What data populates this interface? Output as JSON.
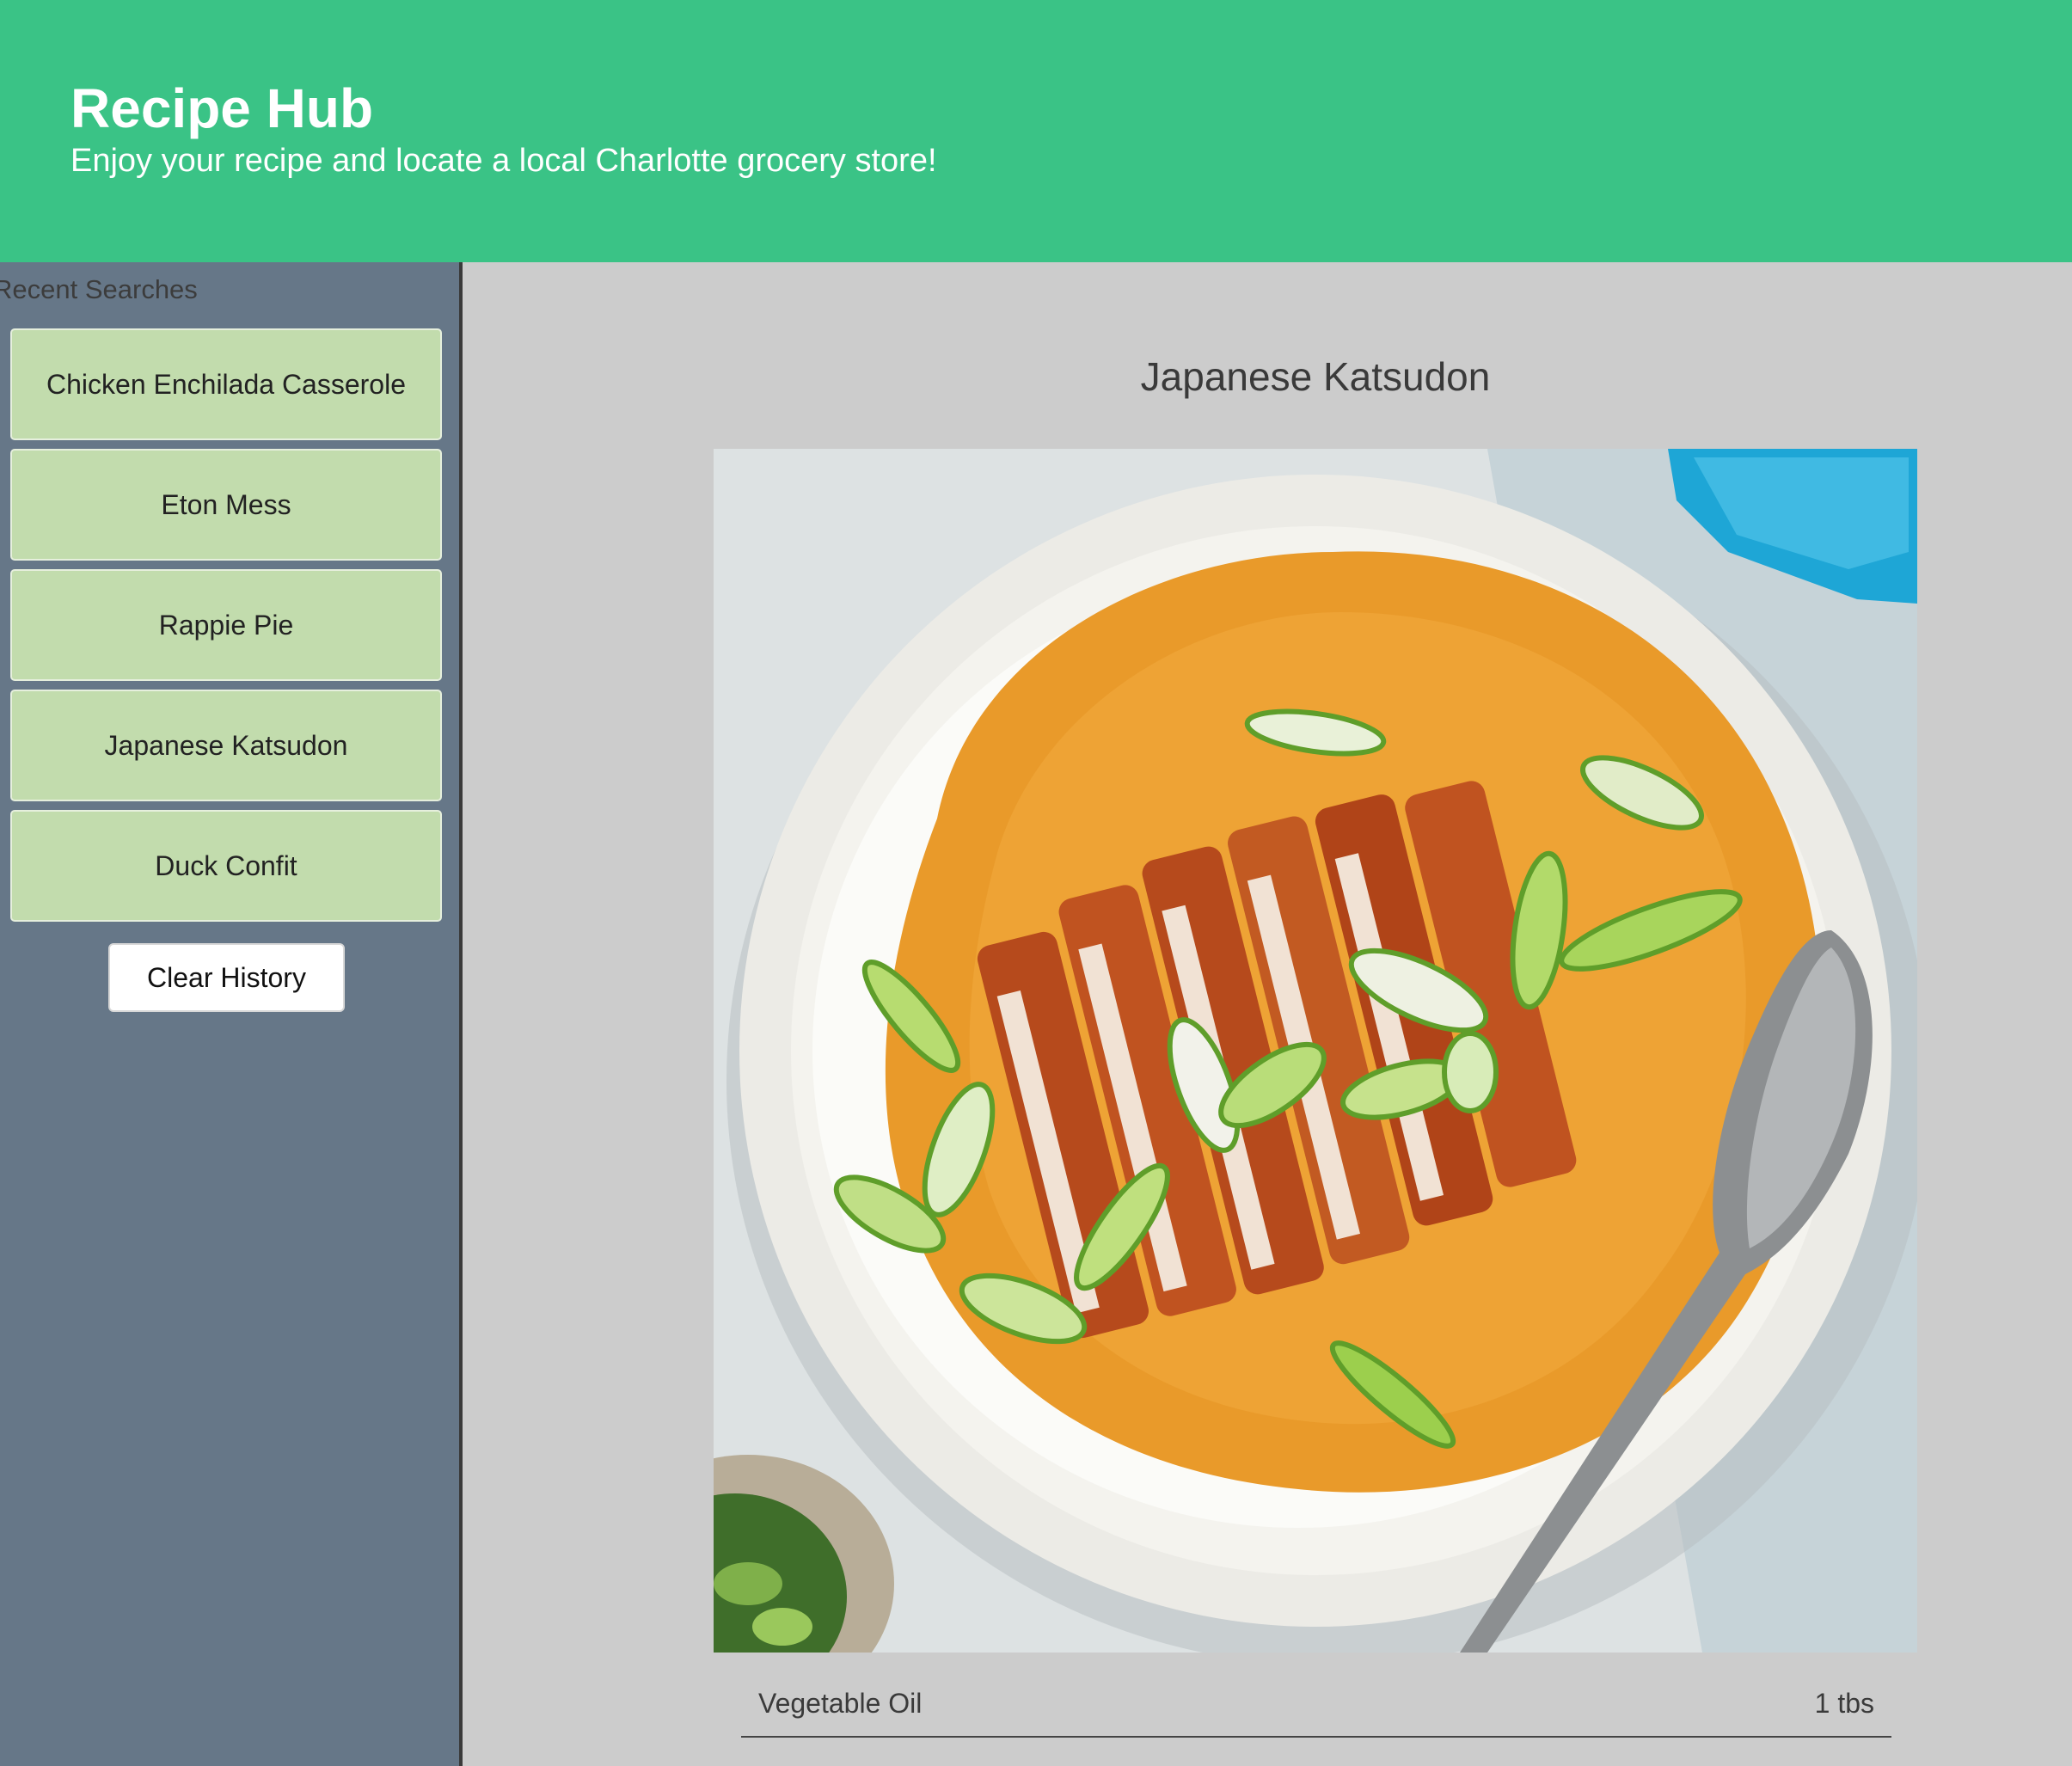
{
  "header": {
    "title": "Recipe Hub",
    "subtitle": "Enjoy your recipe and locate a local Charlotte grocery store!"
  },
  "sidebar": {
    "heading": "Recent Searches",
    "items": [
      {
        "label": "Chicken Enchilada Casserole"
      },
      {
        "label": "Eton Mess"
      },
      {
        "label": "Rappie Pie"
      },
      {
        "label": "Japanese Katsudon"
      },
      {
        "label": "Duck Confit"
      }
    ],
    "clear_label": "Clear History"
  },
  "main": {
    "recipe_title": "Japanese Katsudon",
    "image_subject": "katsudon-bowl-photo",
    "ingredients": [
      {
        "name": "Vegetable Oil",
        "qty": "1 tbs"
      }
    ]
  },
  "colors": {
    "header_bg": "#3ac386",
    "sidebar_bg": "#667788",
    "item_bg": "#c2dcad",
    "main_bg": "#cccccc"
  }
}
